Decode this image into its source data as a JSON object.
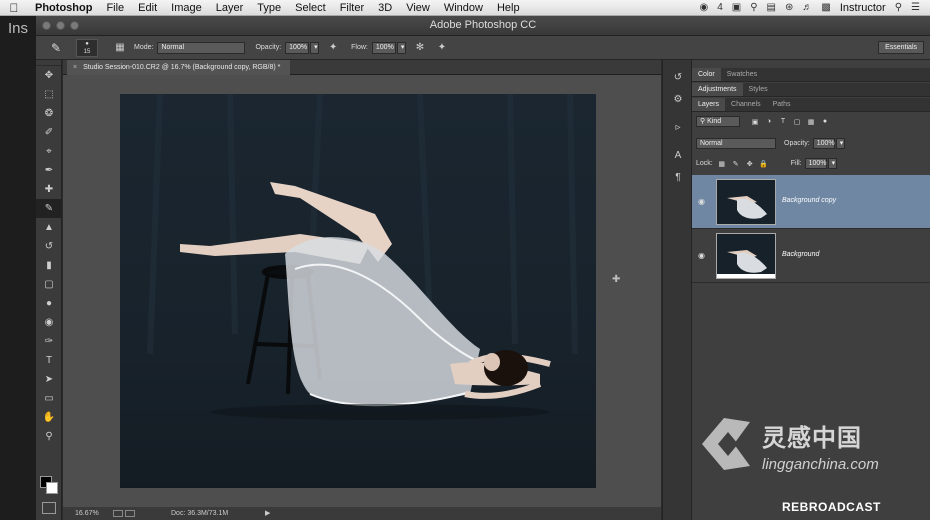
{
  "menubar": {
    "app_name": "Photoshop",
    "items": [
      "File",
      "Edit",
      "Image",
      "Layer",
      "Type",
      "Select",
      "Filter",
      "3D",
      "View",
      "Window",
      "Help"
    ],
    "notification_count": "4",
    "user": "Instructor"
  },
  "background_app": {
    "title_fragment": "Ins"
  },
  "window": {
    "title": "Adobe Photoshop CC"
  },
  "options_bar": {
    "brush_size": "15",
    "mode_label": "Mode:",
    "mode_value": "Normal",
    "opacity_label": "Opacity:",
    "opacity_value": "100%",
    "flow_label": "Flow:",
    "flow_value": "100%",
    "workspace": "Essentials"
  },
  "tools": [
    "move-tool",
    "marquee-tool",
    "lasso-tool",
    "quick-select-tool",
    "crop-tool",
    "eyedropper-tool",
    "healing-brush-tool",
    "brush-tool",
    "clone-stamp-tool",
    "history-brush-tool",
    "eraser-tool",
    "gradient-tool",
    "blur-tool",
    "dodge-tool",
    "pen-tool",
    "type-tool",
    "path-select-tool",
    "rectangle-tool",
    "hand-tool",
    "zoom-tool"
  ],
  "document": {
    "tab_title": "Studio Session-010.CR2 @ 16.7% (Background copy, RGB/8) *",
    "zoom": "16.67%",
    "doc_size": "Doc: 36.3M/73.1M"
  },
  "panels": {
    "color_tabs": [
      "Color",
      "Swatches"
    ],
    "adjust_tabs": [
      "Adjustments",
      "Styles"
    ],
    "layer_tabs": [
      "Layers",
      "Channels",
      "Paths"
    ],
    "filter_kind": "Kind",
    "blend_mode": "Normal",
    "opacity_label": "Opacity:",
    "opacity_value": "100%",
    "lock_label": "Lock:",
    "fill_label": "Fill:",
    "fill_value": "100%",
    "layers": [
      {
        "name": "Background copy",
        "selected": true
      },
      {
        "name": "Background",
        "selected": false
      }
    ]
  },
  "watermark": {
    "chinese": "灵感中国",
    "latin": "lingganchina.com"
  },
  "broadcast_label": "REBROADCAST"
}
